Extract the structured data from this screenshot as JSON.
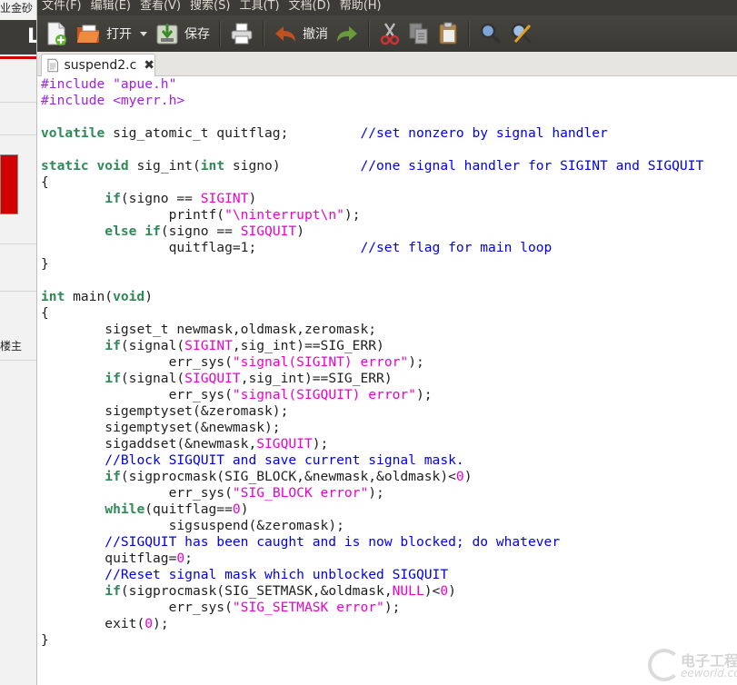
{
  "background_window": {
    "top_text": "业金砂（",
    "floor_label": "楼主"
  },
  "menubar": {
    "items": [
      "文件(F)",
      "编辑(E)",
      "查看(V)",
      "搜索(S)",
      "工具(T)",
      "文档(D)",
      "帮助(H)"
    ]
  },
  "toolbar": {
    "open_label": "打开",
    "save_label": "保存",
    "undo_label": "撤消"
  },
  "tab": {
    "filename": "suspend2.c",
    "close_glyph": "✖"
  },
  "colors": {
    "preprocessor": "#a020f0",
    "string": "#ee00cc",
    "keyword": "#2e8b57",
    "comment": "#0000ee",
    "toolbar_bg": "#3c3b37"
  },
  "watermark": {
    "line1": "电子工程世界",
    "line2": "eeworld.com.cn"
  }
}
